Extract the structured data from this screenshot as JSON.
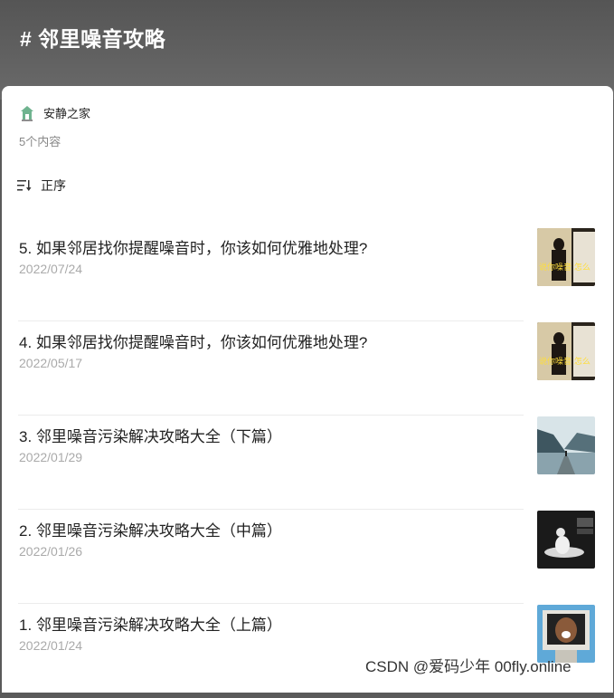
{
  "header": {
    "title": "# 邻里噪音攻略"
  },
  "account": {
    "name": "安静之家",
    "avatar_icon": "house-logo-icon"
  },
  "content_count": "5个内容",
  "sort": {
    "label": "正序",
    "icon": "sort-lines-icon"
  },
  "articles": [
    {
      "title": "5. 如果邻居找你提醒噪音时，你该如何优雅地处理?",
      "date": "2022/07/24",
      "thumb_text": "说你噪音 怎么"
    },
    {
      "title": "4. 如果邻居找你提醒噪音时，你该如何优雅地处理?",
      "date": "2022/05/17",
      "thumb_text": "说你噪音 怎么"
    },
    {
      "title": "3. 邻里噪音污染解决攻略大全（下篇）",
      "date": "2022/01/29"
    },
    {
      "title": "2. 邻里噪音污染解决攻略大全（中篇）",
      "date": "2022/01/26"
    },
    {
      "title": "1. 邻里噪音污染解决攻略大全（上篇）",
      "date": "2022/01/24"
    }
  ],
  "watermark": "CSDN @爱码少年 00fly.online"
}
